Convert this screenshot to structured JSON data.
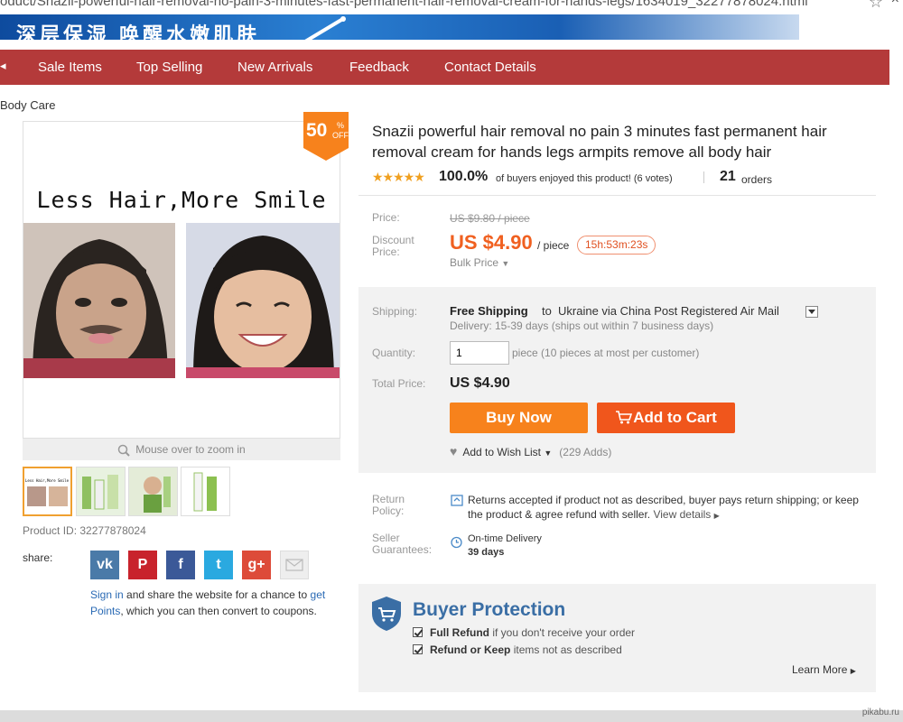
{
  "browser": {
    "url": "oduct/Snazii-powerful-hair-removal-no-pain-3-minutes-fast-permanent-hair-removal-cream-for-hands-legs/1634019_32277878024.html"
  },
  "banner": {
    "text": "深层保湿 唤醒水嫩肌肤"
  },
  "nav": {
    "items": [
      "Sale Items",
      "Top Selling",
      "New Arrivals",
      "Feedback",
      "Contact Details"
    ]
  },
  "breadcrumb": "Body Care",
  "gallery": {
    "slogan": "Less Hair,More Smile",
    "badge_number": "50",
    "badge_pct": "%",
    "badge_off": "OFF",
    "zoom_hint": "Mouse over to zoom in",
    "thumb_slogan": "Less Hair,More Smile"
  },
  "product": {
    "title": "Snazii powerful hair removal no pain 3 minutes fast permanent hair removal cream for hands legs armpits remove all body hair",
    "id_label": "Product ID: 32277878024",
    "rating_stars": "★★★★★",
    "rating_pct": "100.0%",
    "rating_text": "of buyers enjoyed this product! (6 votes)",
    "orders_num": "21",
    "orders_label": "orders"
  },
  "price": {
    "price_label": "Price:",
    "old_price": "US $9.80 / piece",
    "discount_label_1": "Discount",
    "discount_label_2": "Price:",
    "discount_price": "US $4.90",
    "unit": "/ piece",
    "timer": "15h:53m:23s",
    "bulk": "Bulk Price"
  },
  "shipping": {
    "label": "Shipping:",
    "free": "Free Shipping",
    "to": "to",
    "destination": "Ukraine via China Post Registered Air Mail",
    "delivery": "Delivery: 15-39 days (ships out within 7 business days)",
    "quantity_label": "Quantity:",
    "quantity_value": "1",
    "quantity_note": "piece (10 pieces at most per customer)",
    "total_label": "Total Price:",
    "total_value": "US $4.90",
    "buy_now": "Buy Now",
    "add_to_cart": "Add to Cart",
    "wish_label": "Add to Wish List",
    "wish_count": "(229 Adds)"
  },
  "policy": {
    "return_label_1": "Return",
    "return_label_2": "Policy:",
    "return_text": "Returns accepted if product not as described, buyer pays return shipping; or keep the product & agree refund with seller.",
    "view_details": "View details",
    "seller_label_1": "Seller",
    "seller_label_2": "Guarantees:",
    "ontime": "On-time Delivery",
    "days": "39 days"
  },
  "buyer_protection": {
    "title": "Buyer Protection",
    "line1_bold": "Full Refund",
    "line1_rest": "if you don't receive your order",
    "line2_bold": "Refund or Keep",
    "line2_rest": "items not as described",
    "learn_more": "Learn More"
  },
  "share": {
    "label": "share:",
    "buttons": [
      "vk",
      "P",
      "f",
      "t",
      "g+",
      "mail"
    ],
    "sign_in": "Sign in",
    "text_mid": "and share the website for a chance to",
    "get_points": "get Points",
    "text_end": ", which you can then convert to coupons."
  },
  "watermark": "pikabu.ru",
  "colors": {
    "nav": "#b43a3a",
    "price": "#f06020",
    "buy_now": "#f7821c",
    "add_to_cart": "#f0561c",
    "badge": "#f7821c",
    "link": "#2a6ab4",
    "protection": "#3a6ea5"
  },
  "icons": [
    "star-icon",
    "close-icon",
    "magnifier-icon",
    "chevron-down-icon",
    "cart-icon",
    "heart-icon",
    "return-icon",
    "clock-icon",
    "shield-cart-icon",
    "check-icon",
    "chevron-right-icon",
    "mail-icon"
  ]
}
